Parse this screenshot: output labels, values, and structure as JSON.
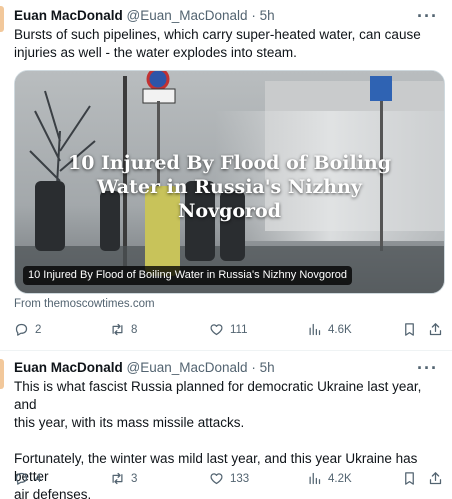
{
  "colors": {
    "text_primary": "#0f1419",
    "text_secondary": "#536471",
    "divider": "#eff3f4",
    "avatar_accent": "#f2c89b"
  },
  "tweets": [
    {
      "author_name": "Euan MacDonald",
      "author_handle": "@Euan_MacDonald",
      "separator": "·",
      "time": "5h",
      "more_label": "···",
      "text_lines": [
        "Bursts of such pipelines, which carry super-heated water, can cause",
        "injuries as well - the water explodes into steam."
      ],
      "card": {
        "headline": "10 Injured By Flood of Boiling Water in Russia's Nizhny Novgorod",
        "caption": "10 Injured By Flood of Boiling Water in Russia's Nizhny Novgorod",
        "source": "From themoscowtimes.com"
      },
      "actions": {
        "replies": "2",
        "reposts": "8",
        "likes": "111",
        "views": "4.6K"
      }
    },
    {
      "author_name": "Euan MacDonald",
      "author_handle": "@Euan_MacDonald",
      "separator": "·",
      "time": "5h",
      "more_label": "···",
      "text_lines": [
        "This is what fascist Russia planned for democratic Ukraine last year, and",
        "this year, with its mass missile attacks.",
        "",
        "Fortunately, the winter was mild last year, and this year Ukraine has better",
        "air defenses."
      ],
      "actions": {
        "replies": "4",
        "reposts": "3",
        "likes": "133",
        "views": "4.2K"
      }
    }
  ]
}
